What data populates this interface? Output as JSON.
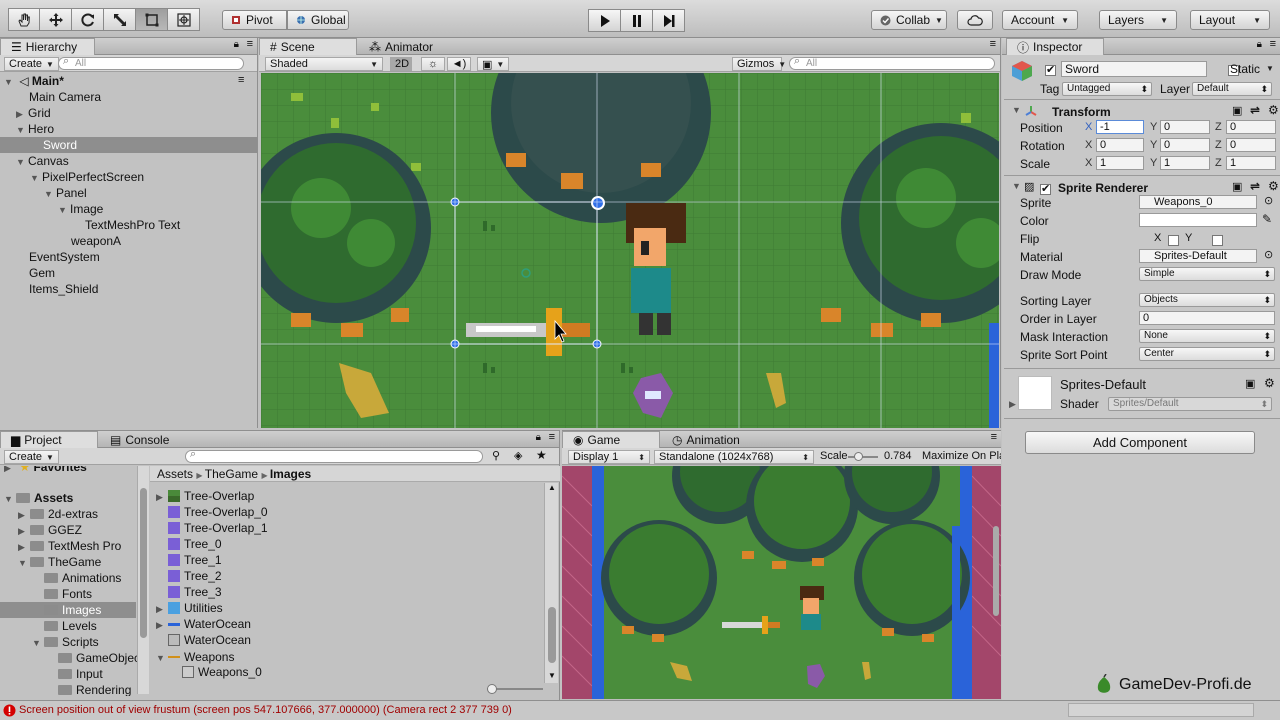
{
  "toolbar": {
    "tools": [
      "hand-tool",
      "move-tool",
      "rotate-tool",
      "scale-tool",
      "rect-tool",
      "transform-tool"
    ],
    "pivot_label": "Pivot",
    "global_label": "Global",
    "collab_label": "Collab",
    "account_label": "Account",
    "layers_label": "Layers",
    "layout_label": "Layout"
  },
  "hierarchy": {
    "tab": "Hierarchy",
    "create_label": "Create",
    "search_placeholder": "All",
    "scene_name": "Main*",
    "items": [
      {
        "label": "Main Camera"
      },
      {
        "label": "Grid"
      },
      {
        "label": "Hero"
      },
      {
        "label": "Sword"
      },
      {
        "label": "Canvas"
      },
      {
        "label": "PixelPerfectScreen"
      },
      {
        "label": "Panel"
      },
      {
        "label": "Image"
      },
      {
        "label": "TextMeshPro Text"
      },
      {
        "label": "weaponA"
      },
      {
        "label": "EventSystem"
      },
      {
        "label": "Gem"
      },
      {
        "label": "Items_Shield"
      }
    ]
  },
  "scene": {
    "tab_scene": "Scene",
    "tab_animator": "Animator",
    "shading": "Shaded",
    "mode_2d": "2D",
    "gizmos_label": "Gizmos",
    "search_placeholder": "All"
  },
  "inspector": {
    "tab": "Inspector",
    "object_name": "Sword",
    "static_label": "Static",
    "tag_label": "Tag",
    "tag_value": "Untagged",
    "layer_label": "Layer",
    "layer_value": "Default",
    "transform": {
      "title": "Transform",
      "position_label": "Position",
      "rotation_label": "Rotation",
      "scale_label": "Scale",
      "position": {
        "x": "-1",
        "y": "0",
        "z": "0"
      },
      "rotation": {
        "x": "0",
        "y": "0",
        "z": "0"
      },
      "scale": {
        "x": "1",
        "y": "1",
        "z": "1"
      },
      "x_label": "X",
      "y_label": "Y",
      "z_label": "Z"
    },
    "sprite_renderer": {
      "title": "Sprite Renderer",
      "sprite_label": "Sprite",
      "sprite_value": "Weapons_0",
      "color_label": "Color",
      "flip_label": "Flip",
      "flip_x": "X",
      "flip_y": "Y",
      "material_label": "Material",
      "material_value": "Sprites-Default",
      "draw_mode_label": "Draw Mode",
      "draw_mode_value": "Simple",
      "sorting_layer_label": "Sorting Layer",
      "sorting_layer_value": "Objects",
      "order_label": "Order in Layer",
      "order_value": "0",
      "mask_label": "Mask Interaction",
      "mask_value": "None",
      "sort_point_label": "Sprite Sort Point",
      "sort_point_value": "Center"
    },
    "material_block": {
      "name": "Sprites-Default",
      "shader_label": "Shader",
      "shader_value": "Sprites/Default"
    },
    "add_component_label": "Add Component",
    "watermark": "GameDev-Profi.de"
  },
  "project": {
    "tab_project": "Project",
    "tab_console": "Console",
    "create_label": "Create",
    "favorites_label": "Favorites",
    "tree": [
      {
        "label": "Assets",
        "level": 0
      },
      {
        "label": "2d-extras",
        "level": 1
      },
      {
        "label": "GGEZ",
        "level": 1
      },
      {
        "label": "TextMesh Pro",
        "level": 1
      },
      {
        "label": "TheGame",
        "level": 1
      },
      {
        "label": "Animations",
        "level": 2
      },
      {
        "label": "Fonts",
        "level": 2
      },
      {
        "label": "Images",
        "level": 2
      },
      {
        "label": "Levels",
        "level": 2
      },
      {
        "label": "Scripts",
        "level": 2
      },
      {
        "label": "GameObjec",
        "level": 3
      },
      {
        "label": "Input",
        "level": 3
      },
      {
        "label": "Rendering",
        "level": 3
      }
    ],
    "breadcrumb": [
      "Assets",
      "TheGame",
      "Images"
    ],
    "assets": [
      {
        "label": "Tree-Overlap"
      },
      {
        "label": "Tree-Overlap_0"
      },
      {
        "label": "Tree-Overlap_1"
      },
      {
        "label": "Tree_0"
      },
      {
        "label": "Tree_1"
      },
      {
        "label": "Tree_2"
      },
      {
        "label": "Tree_3"
      },
      {
        "label": "Utilities"
      },
      {
        "label": "WaterOcean"
      },
      {
        "label": "WaterOcean"
      },
      {
        "label": "Weapons"
      },
      {
        "label": "Weapons_0"
      }
    ]
  },
  "game": {
    "tab_game": "Game",
    "tab_animation": "Animation",
    "display_value": "Display 1",
    "resolution_value": "Standalone (1024x768)",
    "scale_label": "Scale",
    "scale_value": "0.784",
    "maximize_label": "Maximize On Play"
  },
  "status": {
    "message": "Screen position out of view frustum (screen pos 547.107666, 377.000000) (Camera rect 2 377 739 0)",
    "error_color": "#d40000"
  }
}
